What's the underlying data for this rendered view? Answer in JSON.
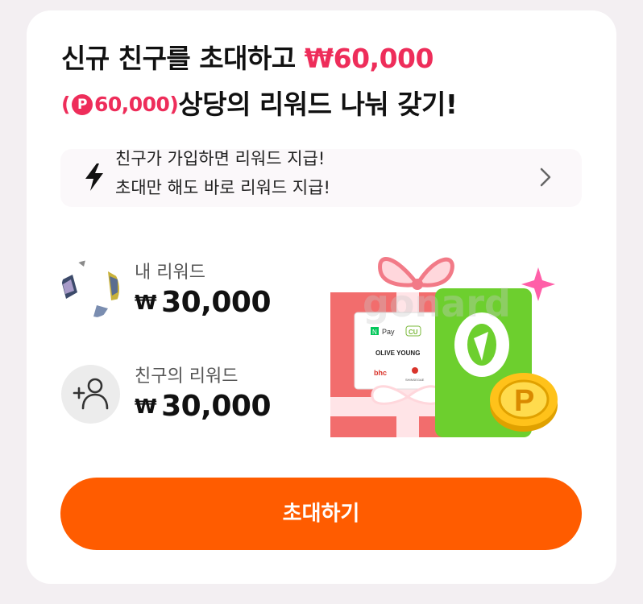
{
  "headline": {
    "line1_text": "신규 친구를 초대하고 ",
    "line1_amount": "₩60,000",
    "line2_open": "(",
    "line2_point_symbol": "P",
    "line2_point_amount": "60,000)",
    "line2_text": "상당의 리워드 나눠 갖기!"
  },
  "notice": {
    "line_top": "친구가 가입하면 리워드 지급!",
    "line_bottom": "초대만 해도 바로 리워드 지급!"
  },
  "my_reward": {
    "label": "내 리워드",
    "currency": "₩",
    "amount": "30,000"
  },
  "friend_reward": {
    "label": "친구의 리워드",
    "currency": "₩",
    "amount": "30,000"
  },
  "gift": {
    "brands": [
      "N Pay",
      "CU",
      "OLIVE YOUNG",
      "bhc",
      "SHINSEGAE"
    ],
    "coin_symbol": "P",
    "watermark": "gonard"
  },
  "invite_button": {
    "label": "초대하기"
  },
  "colors": {
    "accent": "#ee2d5a",
    "button": "#ff5c00",
    "gift_box": "#f26d6d",
    "voucher_green": "#6dcf2e"
  }
}
